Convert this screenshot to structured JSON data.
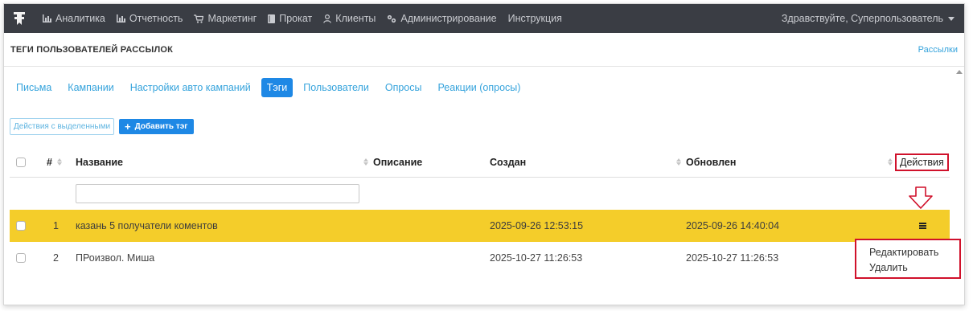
{
  "nav": {
    "items": [
      {
        "label": "Аналитика",
        "icon": "bar-chart-icon"
      },
      {
        "label": "Отчетность",
        "icon": "bar-chart-icon"
      },
      {
        "label": "Маркетинг",
        "icon": "cart-icon"
      },
      {
        "label": "Прокат",
        "icon": "book-icon"
      },
      {
        "label": "Клиенты",
        "icon": "user-icon"
      },
      {
        "label": "Администрирование",
        "icon": "cogs-icon"
      },
      {
        "label": "Инструкция",
        "icon": ""
      }
    ],
    "user_greeting": "Здравствуйте, Суперпользователь"
  },
  "page": {
    "title": "ТЕГИ ПОЛЬЗОВАТЕЛЕЙ РАССЫЛОК",
    "breadcrumb_link": "Рассылки"
  },
  "tabs": [
    {
      "label": "Письма",
      "active": false
    },
    {
      "label": "Кампании",
      "active": false
    },
    {
      "label": "Настройки авто кампаний",
      "active": false
    },
    {
      "label": "Тэги",
      "active": true
    },
    {
      "label": "Пользователи",
      "active": false
    },
    {
      "label": "Опросы",
      "active": false
    },
    {
      "label": "Реакции (опросы)",
      "active": false
    }
  ],
  "toolbar": {
    "bulk_actions_label": "Действия с выделенными",
    "add_tag_label": "Добавить тэг"
  },
  "table": {
    "headers": {
      "num": "#",
      "name": "Название",
      "description": "Описание",
      "created": "Создан",
      "updated": "Обновлен",
      "actions": "Действия"
    },
    "rows": [
      {
        "num": "1",
        "name": "казань 5 получатели коментов",
        "description": "",
        "created": "2025-09-26 12:53:15",
        "updated": "2025-09-26 14:40:04",
        "selected": true
      },
      {
        "num": "2",
        "name": "ПРоизвол. Миша",
        "description": "",
        "created": "2025-10-27 11:26:53",
        "updated": "2025-10-27 11:26:53",
        "selected": false
      }
    ]
  },
  "row_menu": {
    "edit_label": "Редактировать",
    "delete_label": "Удалить"
  },
  "colors": {
    "nav_bg": "#3a3d44",
    "accent": "#1e88e5",
    "link": "#35a3dc",
    "selected_row": "#f4cd2a",
    "annotation": "#d0112b"
  }
}
